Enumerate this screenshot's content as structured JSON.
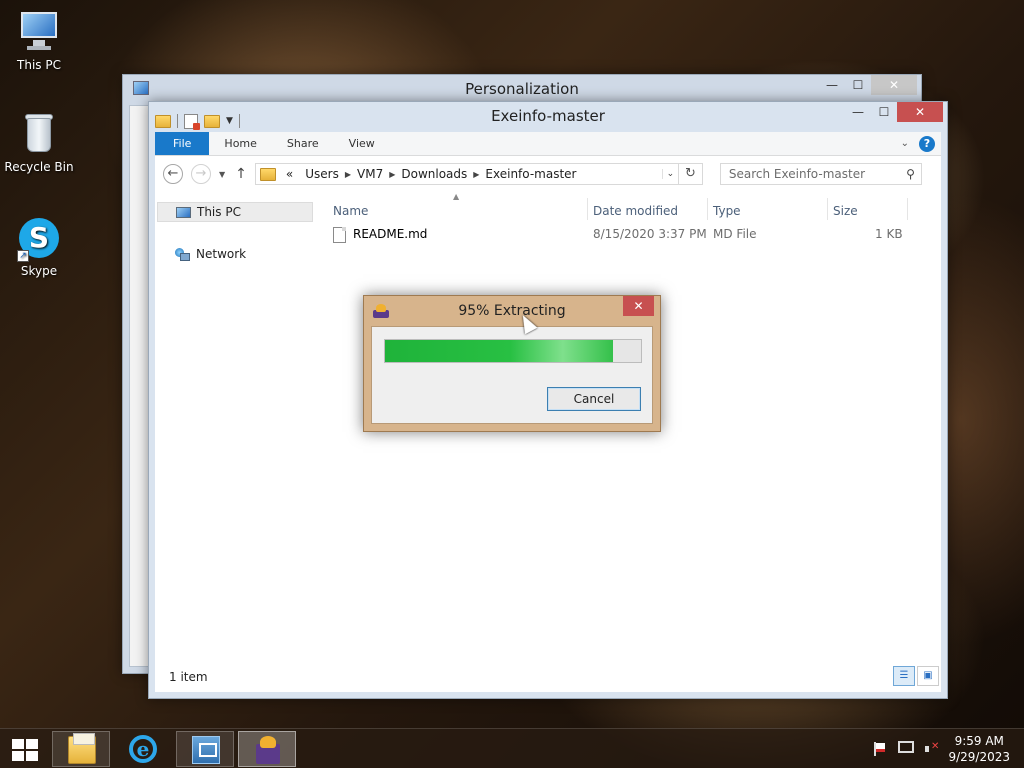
{
  "desktop": {
    "icons": [
      {
        "label": "This PC"
      },
      {
        "label": "Recycle Bin"
      },
      {
        "label": "Skype"
      }
    ]
  },
  "personalization_window": {
    "title": "Personalization",
    "minimize": "—",
    "maximize": "☐",
    "close": "✕"
  },
  "explorer": {
    "title": "Exeinfo-master",
    "minimize": "—",
    "maximize": "☐",
    "close": "✕",
    "ribbon_tabs": [
      "File",
      "Home",
      "Share",
      "View"
    ],
    "help": "?",
    "nav": {
      "back": "←",
      "forward": "→",
      "up": "↑",
      "address_prefix": "«",
      "breadcrumbs": [
        "Users",
        "VM7",
        "Downloads",
        "Exeinfo-master"
      ],
      "refresh": "↻",
      "search_placeholder": "Search Exeinfo-master"
    },
    "nav_pane": [
      {
        "label": "This PC"
      },
      {
        "label": "Network"
      }
    ],
    "columns": [
      "Name",
      "Date modified",
      "Type",
      "Size"
    ],
    "files": [
      {
        "name": "README.md",
        "modified": "8/15/2020 3:37 PM",
        "type": "MD File",
        "size": "1 KB"
      }
    ],
    "status": "1 item"
  },
  "extract_dialog": {
    "title": "95% Extracting",
    "close": "✕",
    "progress": 0.89,
    "cancel_label": "Cancel"
  },
  "taskbar": {
    "time": "9:59 AM",
    "date": "9/29/2023"
  }
}
